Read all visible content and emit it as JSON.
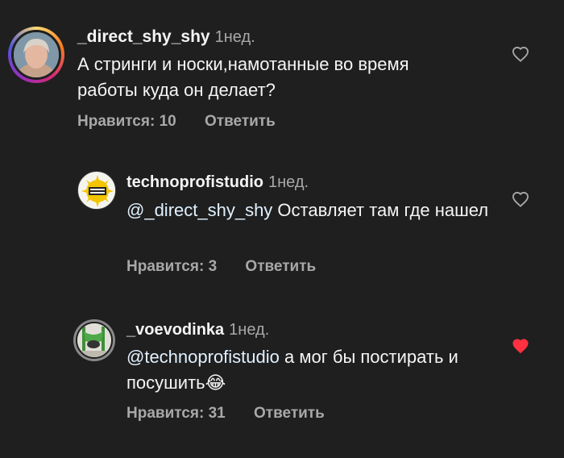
{
  "comments": [
    {
      "username": "_direct_shy_shy",
      "time": "1нед.",
      "text": "А стринги и носки,намотанные во время работы куда он делает?",
      "likes": "Нравится: 10",
      "reply": "Ответить",
      "heart_icon": "heart-outline-icon",
      "liked": false
    },
    {
      "username": "technoprofistudio",
      "time": "1нед.",
      "mention": "@_direct_shy_shy",
      "text": " Оставляет там где нашел",
      "likes": "Нравится: 3",
      "reply": "Ответить",
      "heart_icon": "heart-outline-icon",
      "liked": false
    },
    {
      "username": "_voevodinka",
      "time": "1нед.",
      "mention": "@technoprofistudio",
      "text": " а мог бы постирать и посушить",
      "emoji": "😂",
      "likes": "Нравится: 31",
      "reply": "Ответить",
      "heart_icon": "heart-filled-icon",
      "liked": true
    }
  ],
  "colors": {
    "background": "#1f1f1f",
    "text": "#f5f5f5",
    "secondary": "#a8a8a8",
    "mention": "#e0f1ff",
    "liked_heart": "#ff3040"
  }
}
